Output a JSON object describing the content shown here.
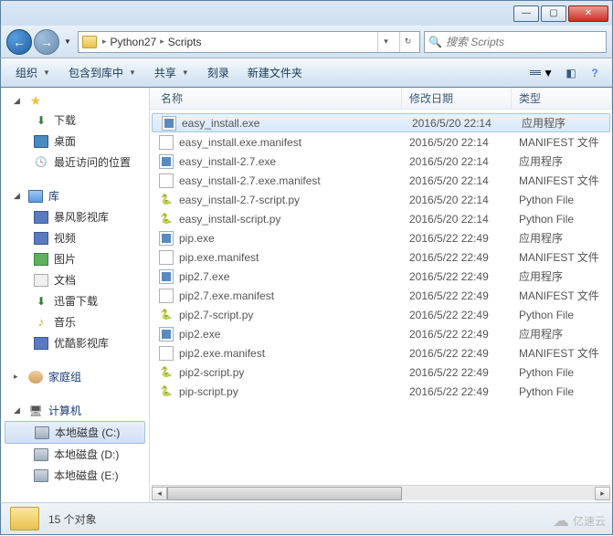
{
  "window_controls": {
    "min": "—",
    "max": "▢",
    "close": "✕"
  },
  "nav": {
    "back": "←",
    "forward": "→",
    "dropdown": "▼",
    "path": [
      "Python27",
      "Scripts"
    ],
    "refresh": "↻",
    "search_placeholder": "搜索 Scripts",
    "search_icon": "🔍"
  },
  "toolbar": {
    "organize": "组织",
    "include": "包含到库中",
    "share": "共享",
    "burn": "刻录",
    "newfolder": "新建文件夹",
    "help": "?"
  },
  "sidebar": {
    "favorites": {
      "label": "",
      "items": [
        {
          "icon": "dl",
          "label": "下载"
        },
        {
          "icon": "desktop",
          "label": "桌面"
        },
        {
          "icon": "recent",
          "label": "最近访问的位置"
        }
      ]
    },
    "libraries": {
      "label": "库",
      "items": [
        {
          "icon": "video",
          "label": "暴风影视库"
        },
        {
          "icon": "video",
          "label": "视频"
        },
        {
          "icon": "pic",
          "label": "图片"
        },
        {
          "icon": "doc",
          "label": "文档"
        },
        {
          "icon": "dl",
          "label": "迅雷下载"
        },
        {
          "icon": "music",
          "label": "音乐"
        },
        {
          "icon": "video",
          "label": "优酷影视库"
        }
      ]
    },
    "homegroup": {
      "label": "家庭组"
    },
    "computer": {
      "label": "计算机",
      "items": [
        {
          "icon": "drive",
          "label": "本地磁盘 (C:)",
          "selected": true
        },
        {
          "icon": "drive",
          "label": "本地磁盘 (D:)"
        },
        {
          "icon": "drive",
          "label": "本地磁盘 (E:)"
        }
      ]
    }
  },
  "columns": {
    "name": "名称",
    "date": "修改日期",
    "type": "类型"
  },
  "files": [
    {
      "icon": "exe",
      "name": "easy_install.exe",
      "date": "2016/5/20 22:14",
      "type": "应用程序",
      "selected": true
    },
    {
      "icon": "manifest",
      "name": "easy_install.exe.manifest",
      "date": "2016/5/20 22:14",
      "type": "MANIFEST 文件"
    },
    {
      "icon": "exe",
      "name": "easy_install-2.7.exe",
      "date": "2016/5/20 22:14",
      "type": "应用程序"
    },
    {
      "icon": "manifest",
      "name": "easy_install-2.7.exe.manifest",
      "date": "2016/5/20 22:14",
      "type": "MANIFEST 文件"
    },
    {
      "icon": "py",
      "name": "easy_install-2.7-script.py",
      "date": "2016/5/20 22:14",
      "type": "Python File"
    },
    {
      "icon": "py",
      "name": "easy_install-script.py",
      "date": "2016/5/20 22:14",
      "type": "Python File"
    },
    {
      "icon": "exe",
      "name": "pip.exe",
      "date": "2016/5/22 22:49",
      "type": "应用程序"
    },
    {
      "icon": "manifest",
      "name": "pip.exe.manifest",
      "date": "2016/5/22 22:49",
      "type": "MANIFEST 文件"
    },
    {
      "icon": "exe",
      "name": "pip2.7.exe",
      "date": "2016/5/22 22:49",
      "type": "应用程序"
    },
    {
      "icon": "manifest",
      "name": "pip2.7.exe.manifest",
      "date": "2016/5/22 22:49",
      "type": "MANIFEST 文件"
    },
    {
      "icon": "py",
      "name": "pip2.7-script.py",
      "date": "2016/5/22 22:49",
      "type": "Python File"
    },
    {
      "icon": "exe",
      "name": "pip2.exe",
      "date": "2016/5/22 22:49",
      "type": "应用程序"
    },
    {
      "icon": "manifest",
      "name": "pip2.exe.manifest",
      "date": "2016/5/22 22:49",
      "type": "MANIFEST 文件"
    },
    {
      "icon": "py",
      "name": "pip2-script.py",
      "date": "2016/5/22 22:49",
      "type": "Python File"
    },
    {
      "icon": "py",
      "name": "pip-script.py",
      "date": "2016/5/22 22:49",
      "type": "Python File"
    }
  ],
  "status": {
    "count": "15 个对象"
  },
  "watermark": "亿速云"
}
